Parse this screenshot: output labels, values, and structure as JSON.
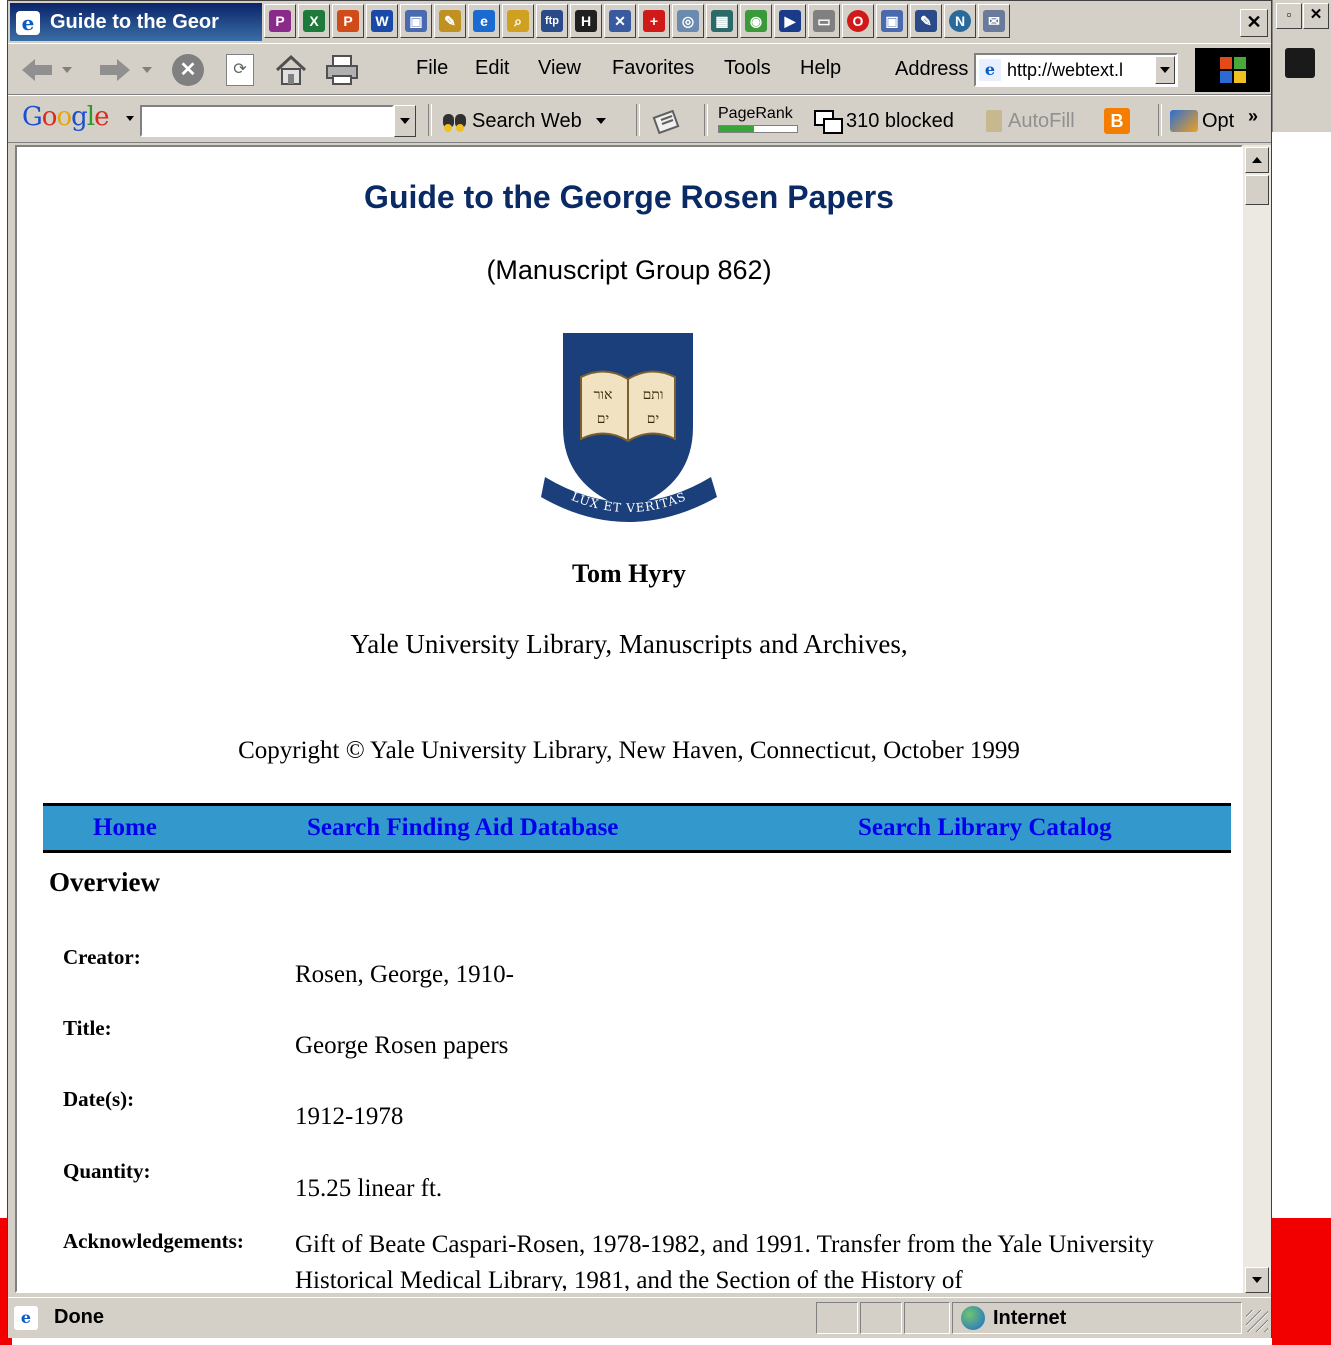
{
  "window": {
    "title": "Guide to the Geor",
    "status": "Done",
    "zone": "Internet"
  },
  "menu": {
    "file": "File",
    "edit": "Edit",
    "view": "View",
    "favorites": "Favorites",
    "tools": "Tools",
    "help": "Help"
  },
  "address": {
    "label": "Address",
    "value": "http://webtext.l"
  },
  "google_toolbar": {
    "search_value": "",
    "search_web_label": "Search Web",
    "pagerank_label": "PageRank",
    "pagerank_fill_percent": 45,
    "blocked_label": "310 blocked",
    "autofill_label": "AutoFill",
    "options_label": "Opt",
    "more_label": "»",
    "blogger_label": "B"
  },
  "desktop": {
    "restore_glyph": "▫",
    "close_glyph": "✕"
  },
  "page": {
    "title": "Guide to the George Rosen Papers",
    "subtitle": "(Manuscript Group 862)",
    "motto": "LUX ET VERITAS",
    "author": "Tom Hyry",
    "institution": "Yale University Library, Manuscripts and Archives,",
    "copyright": "Copyright © Yale University Library, New Haven, Connecticut, October 1999",
    "nav": {
      "home": "Home",
      "finding_aid": "Search Finding Aid Database",
      "catalog": "Search Library Catalog"
    },
    "overview_heading": "Overview",
    "overview": [
      {
        "label": "Creator:",
        "value": "Rosen, George, 1910-"
      },
      {
        "label": "Title:",
        "value": "George Rosen papers"
      },
      {
        "label": "Date(s):",
        "value": "1912-1978"
      },
      {
        "label": "Quantity:",
        "value": "15.25 linear ft."
      },
      {
        "label": "Acknowledgements:",
        "value": "Gift of Beate Caspari-Rosen, 1978-1982, and 1991. Transfer from the Yale University Historical Medical Library, 1981, and the Section of the History of"
      }
    ]
  },
  "colors": {
    "title_blue": "#0a2a66",
    "nav_bar": "#3399cc",
    "link": "#0000ee",
    "shield_blue": "#1b3f7a"
  }
}
